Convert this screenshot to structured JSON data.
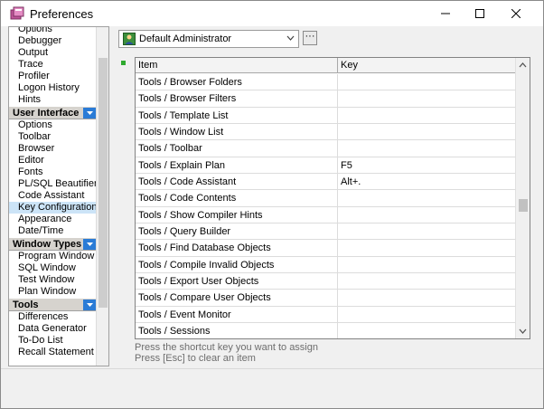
{
  "window": {
    "title": "Preferences"
  },
  "sidebar": {
    "groups": [
      {
        "header": "",
        "items": [
          "Options",
          "Debugger",
          "Output",
          "Trace",
          "Profiler",
          "Logon History",
          "Hints"
        ]
      },
      {
        "header": "User Interface",
        "items": [
          "Options",
          "Toolbar",
          "Browser",
          "Editor",
          "Fonts",
          "PL/SQL Beautifier",
          "Code Assistant",
          "Key Configuration",
          "Appearance",
          "Date/Time"
        ]
      },
      {
        "header": "Window Types",
        "items": [
          "Program Window",
          "SQL Window",
          "Test Window",
          "Plan Window"
        ]
      },
      {
        "header": "Tools",
        "items": [
          "Differences",
          "Data Generator",
          "To-Do List",
          "Recall Statement"
        ]
      }
    ],
    "selected": "Key Configuration"
  },
  "profile": {
    "value": "Default Administrator",
    "more_label": "···"
  },
  "grid": {
    "columns": [
      "Item",
      "Key"
    ],
    "rows": [
      {
        "item": "Tools / Browser Folders",
        "key": ""
      },
      {
        "item": "Tools / Browser Filters",
        "key": ""
      },
      {
        "item": "Tools / Template List",
        "key": ""
      },
      {
        "item": "Tools / Window List",
        "key": ""
      },
      {
        "item": "Tools / Toolbar",
        "key": ""
      },
      {
        "item": "Tools / Explain Plan",
        "key": "F5"
      },
      {
        "item": "Tools / Code Assistant",
        "key": "Alt+."
      },
      {
        "item": "Tools / Code Contents",
        "key": ""
      },
      {
        "item": "Tools / Show Compiler Hints",
        "key": ""
      },
      {
        "item": "Tools / Query Builder",
        "key": ""
      },
      {
        "item": "Tools / Find Database Objects",
        "key": ""
      },
      {
        "item": "Tools / Compile Invalid Objects",
        "key": ""
      },
      {
        "item": "Tools / Export User Objects",
        "key": ""
      },
      {
        "item": "Tools / Compare User Objects",
        "key": ""
      },
      {
        "item": "Tools / Event Monitor",
        "key": ""
      },
      {
        "item": "Tools / Sessions",
        "key": ""
      }
    ]
  },
  "hints": {
    "line1": "Press the shortcut key you want to assign",
    "line2": "Press [Esc] to clear an item"
  },
  "colors": {
    "selection": "#cce4f7",
    "group_header_button": "#2a7bd6",
    "marker": "#2eaa2e"
  }
}
